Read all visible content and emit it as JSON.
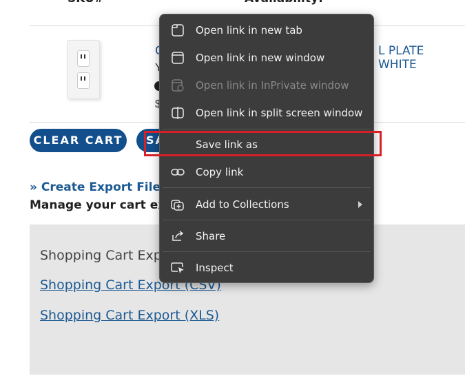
{
  "page": {
    "header_left": "SKU#",
    "header_right": "Availability:",
    "product": {
      "title_start": "C",
      "title_end": "L PLATE WHITE",
      "line2": "Y",
      "price_start": "$"
    },
    "buttons": {
      "clear_cart": "CLEAR CART",
      "save_partial": "SA"
    },
    "export": {
      "create_link": "» Create Export File",
      "manage_text": "Manage your cart exp",
      "box_title": "Shopping Cart Expo",
      "csv_link": "Shopping Cart Export (CSV)",
      "xls_link": "Shopping Cart Export (XLS)"
    }
  },
  "context_menu": {
    "items": [
      {
        "label": "Open link in new tab",
        "icon": "new-tab-icon",
        "enabled": true
      },
      {
        "label": "Open link in new window",
        "icon": "new-window-icon",
        "enabled": true
      },
      {
        "label": "Open link in InPrivate window",
        "icon": "inprivate-icon",
        "enabled": false
      },
      {
        "label": "Open link in split screen window",
        "icon": "split-screen-icon",
        "enabled": true
      },
      {
        "label": "Save link as",
        "icon": "",
        "enabled": true
      },
      {
        "label": "Copy link",
        "icon": "link-icon",
        "enabled": true
      },
      {
        "label": "Add to Collections",
        "icon": "collections-icon",
        "enabled": true,
        "submenu": true
      },
      {
        "label": "Share",
        "icon": "share-icon",
        "enabled": true
      },
      {
        "label": "Inspect",
        "icon": "inspect-icon",
        "enabled": true
      }
    ],
    "highlighted_item": "Save link as"
  },
  "colors": {
    "menu_bg": "#3c3c3c",
    "link_blue": "#1d5a93",
    "button_blue": "#124f8c",
    "highlight_red": "#d61f26",
    "gray_panel": "#e6e6e6"
  }
}
